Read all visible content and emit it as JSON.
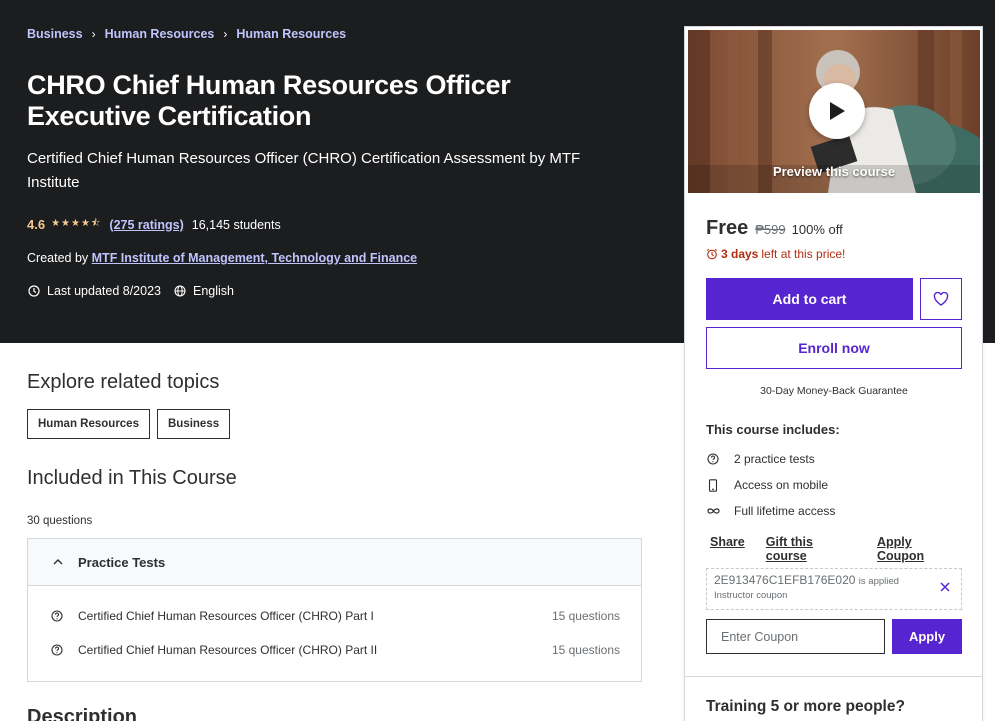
{
  "breadcrumb": [
    "Business",
    "Human Resources",
    "Human Resources"
  ],
  "course": {
    "title": "CHRO Chief Human Resources Officer Executive Certification",
    "subtitle": "Certified Chief Human Resources Officer (CHRO) Certification Assessment by MTF Institute",
    "rating": "4.6",
    "rating_value": 4.6,
    "ratings_link": "(275 ratings)",
    "students": "16,145 students",
    "created_by_label": "Created by",
    "instructor": "MTF Institute of Management, Technology and Finance",
    "last_updated": "Last updated 8/2023",
    "language": "English"
  },
  "sidebar": {
    "preview_label": "Preview this course",
    "price": "Free",
    "original_price": "₱599",
    "discount": "100% off",
    "timer_bold": "3 days",
    "timer_rest": "left at this price!",
    "add_to_cart": "Add to cart",
    "enroll_now": "Enroll now",
    "guarantee": "30-Day Money-Back Guarantee",
    "includes_title": "This course includes:",
    "includes": [
      {
        "icon": "question-circle-icon",
        "text": "2 practice tests"
      },
      {
        "icon": "mobile-icon",
        "text": "Access on mobile"
      },
      {
        "icon": "infinity-icon",
        "text": "Full lifetime access"
      }
    ],
    "links": [
      "Share",
      "Gift this course",
      "Apply Coupon"
    ],
    "coupon_code": "2E913476C1EFB176E020",
    "coupon_applied": "is applied",
    "coupon_type": "Instructor coupon",
    "coupon_placeholder": "Enter Coupon",
    "apply_label": "Apply",
    "training_title": "Training 5 or more people?"
  },
  "related": {
    "heading": "Explore related topics",
    "topics": [
      "Human Resources",
      "Business"
    ]
  },
  "included": {
    "heading": "Included in This Course",
    "count": "30 questions",
    "section_title": "Practice Tests",
    "items": [
      {
        "title": "Certified Chief Human Resources Officer (CHRO) Part I",
        "count": "15 questions"
      },
      {
        "title": "Certified Chief Human Resources Officer (CHRO) Part II",
        "count": "15 questions"
      }
    ]
  },
  "description_heading": "Description",
  "colors": {
    "brand_purple": "#5624d0",
    "header_bg": "#1c1d1f",
    "link_lavender": "#c0c4fc",
    "star_gold": "#f3ca8c",
    "alert_red": "#b32d0f"
  }
}
